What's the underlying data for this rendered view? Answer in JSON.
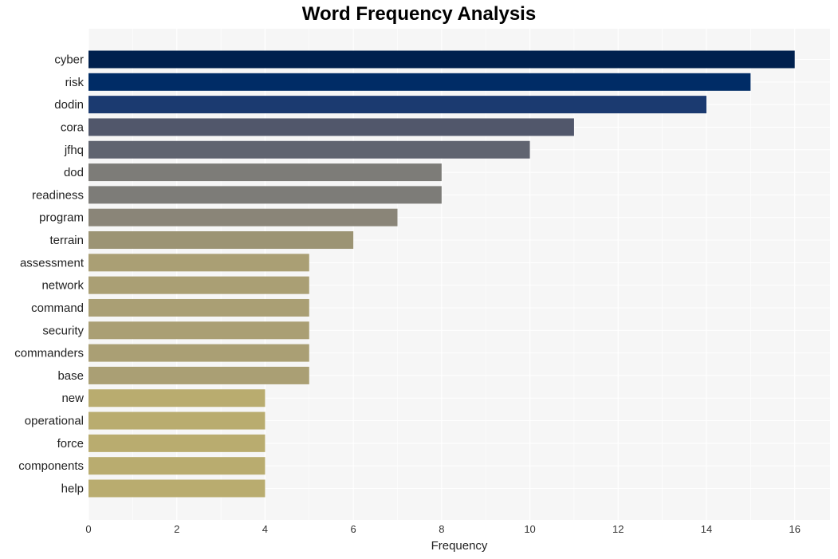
{
  "chart_data": {
    "type": "bar",
    "orientation": "horizontal",
    "title": "Word Frequency Analysis",
    "xlabel": "Frequency",
    "ylabel": "",
    "xlim": [
      0,
      16.8
    ],
    "xticks": [
      0,
      2,
      4,
      6,
      8,
      10,
      12,
      14,
      16
    ],
    "grid": true,
    "legend": "none",
    "categories": [
      "cyber",
      "risk",
      "dodin",
      "cora",
      "jfhq",
      "dod",
      "readiness",
      "program",
      "terrain",
      "assessment",
      "network",
      "command",
      "security",
      "commanders",
      "base",
      "new",
      "operational",
      "force",
      "components",
      "help"
    ],
    "values": [
      16,
      15,
      14,
      11,
      10,
      8,
      8,
      7,
      6,
      5,
      5,
      5,
      5,
      5,
      5,
      4,
      4,
      4,
      4,
      4
    ],
    "colors": [
      "#00204e",
      "#002c66",
      "#1b3a70",
      "#51576b",
      "#606470",
      "#7d7c78",
      "#7d7c78",
      "#8a8578",
      "#9c9474",
      "#aa9f74",
      "#aa9f74",
      "#aa9f74",
      "#aa9f74",
      "#aa9f74",
      "#aa9f74",
      "#b9ac6f",
      "#b9ac6f",
      "#b9ac6f",
      "#b9ac6f",
      "#b9ac6f"
    ]
  },
  "style": {
    "plot_background": "#f6f6f6",
    "grid_color": "#ffffff"
  }
}
